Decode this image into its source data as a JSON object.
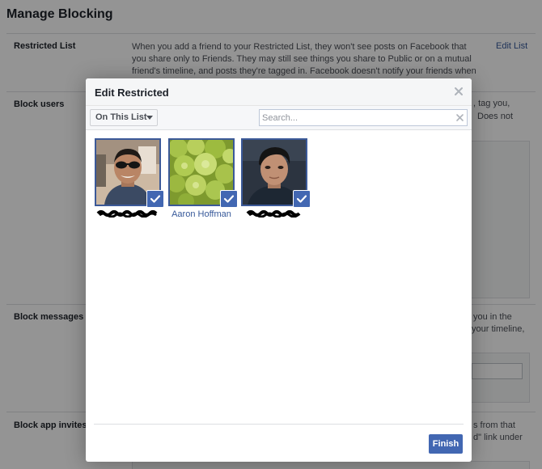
{
  "page": {
    "title": "Manage Blocking",
    "edit_link": "Edit List"
  },
  "sections": [
    {
      "label": "Restricted List",
      "description": "When you add a friend to your Restricted List, they won't see posts on Facebook that you share only to Friends. They may still see things you share to Public or on a mutual friend's timeline, and posts they're tagged in. Facebook doesn't notify your friends when you add them to your Restricted List. Learn more"
    },
    {
      "label": "Block users",
      "fragments": [
        ", tag you,",
        "Does not"
      ]
    },
    {
      "label": "Block messages",
      "fragments": [
        "you in the",
        "your timeline,"
      ]
    },
    {
      "label": "Block app invites",
      "fragments": [
        "s from that",
        "d\" link under"
      ]
    }
  ],
  "dialog": {
    "title": "Edit Restricted",
    "close_icon": "close-icon",
    "filter": {
      "selected": "On This List"
    },
    "search": {
      "placeholder": "Search...",
      "value": ""
    },
    "friends": [
      {
        "name": "",
        "redacted": true,
        "selected": true,
        "photo": "man-with-sunglasses"
      },
      {
        "name": "Aaron Hoffman",
        "redacted": false,
        "selected": true,
        "photo": "romanesco-broccoli"
      },
      {
        "name": "",
        "redacted": true,
        "selected": true,
        "photo": "young-man-portrait"
      }
    ],
    "finish_label": "Finish"
  },
  "colors": {
    "accent": "#4267b2",
    "link": "#365899",
    "selection_border": "#3b5998",
    "overlay": "rgba(0,0,0,0.42)"
  }
}
